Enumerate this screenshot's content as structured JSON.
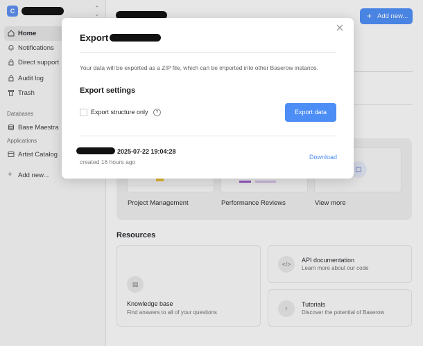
{
  "sidebar": {
    "workspace_initial": "C",
    "items": [
      {
        "label": "Home",
        "icon": "home-icon"
      },
      {
        "label": "Notifications",
        "icon": "bell-icon"
      },
      {
        "label": "Direct support",
        "icon": "lock-icon"
      },
      {
        "label": "Audit log",
        "icon": "lock-icon"
      },
      {
        "label": "Trash",
        "icon": "trash-icon"
      }
    ],
    "databases_label": "Databases",
    "database_item": "Base Maestra",
    "applications_label": "Applications",
    "application_item": "Artist Catalog",
    "add_new": "Add new..."
  },
  "header": {
    "add_new_label": "Add new..."
  },
  "templates": {
    "items": [
      "Project Management",
      "Performance Reviews",
      "View more"
    ]
  },
  "resources": {
    "title": "Resources",
    "cards": [
      {
        "title": "Knowledge base",
        "subtitle": "Find answers to all of your questions",
        "icon": "chat-icon"
      },
      {
        "title": "API documentation",
        "subtitle": "Learn more about our code",
        "icon": "code-icon"
      },
      {
        "title": "Tutorials",
        "subtitle": "Discover the potential of Baserow",
        "icon": "lightbulb-icon"
      }
    ]
  },
  "modal": {
    "title": "Export",
    "description": "Your data will be exported as a ZIP file, which can be imported into other Baserow instance.",
    "settings_title": "Export settings",
    "checkbox_label": "Export structure only",
    "help_symbol": "?",
    "export_button": "Export data",
    "job": {
      "timestamp": "2025-07-22 19:04:28",
      "created": "created 16 hours ago",
      "download": "Download"
    }
  },
  "colors": {
    "accent": "#4c8df6",
    "redaction": "#111111"
  }
}
